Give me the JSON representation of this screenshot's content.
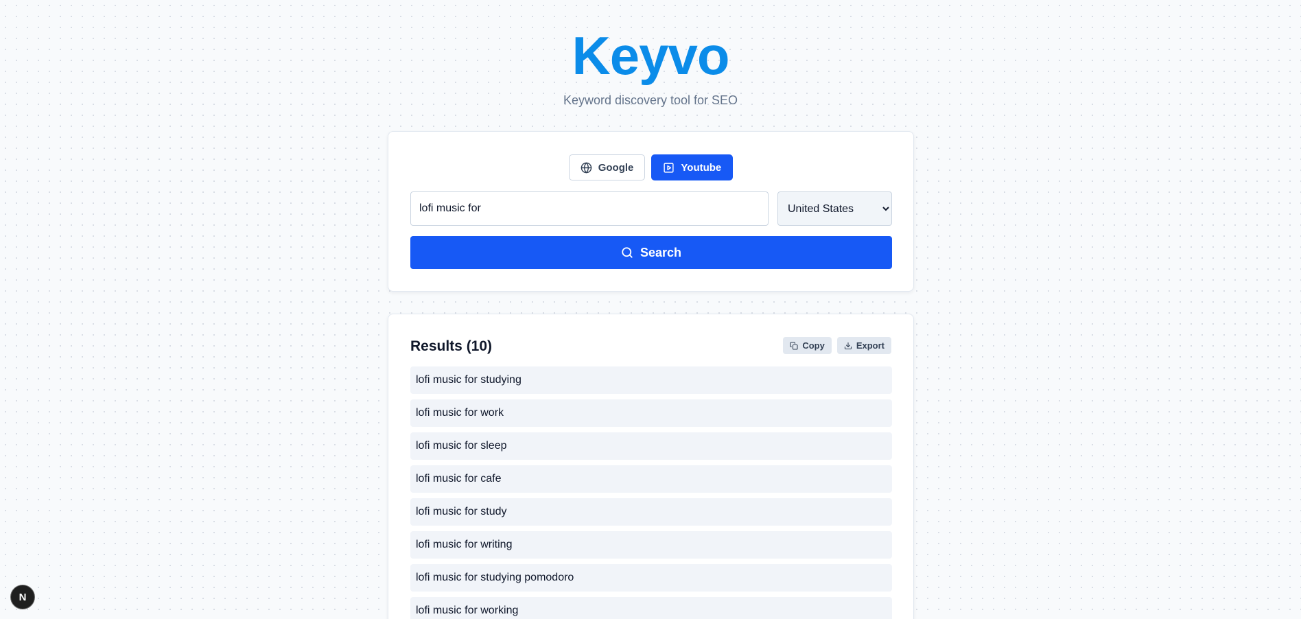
{
  "header": {
    "brand": "Keyvo",
    "tagline": "Keyword discovery tool for SEO"
  },
  "engines": {
    "google_label": "Google",
    "youtube_label": "Youtube",
    "selected": "Youtube"
  },
  "search": {
    "query_value": "lofi music for",
    "country_selected": "United States",
    "button_label": "Search"
  },
  "results": {
    "title": "Results (10)",
    "copy_label": "Copy",
    "export_label": "Export",
    "items": [
      "lofi music for studying",
      "lofi music for work",
      "lofi music for sleep",
      "lofi music for cafe",
      "lofi music for study",
      "lofi music for writing",
      "lofi music for studying pomodoro",
      "lofi music for working"
    ]
  },
  "badge": {
    "letter": "N"
  },
  "colors": {
    "brand": "#0b8ce9",
    "primary": "#1759f5",
    "row_bg": "#f1f4f9"
  }
}
